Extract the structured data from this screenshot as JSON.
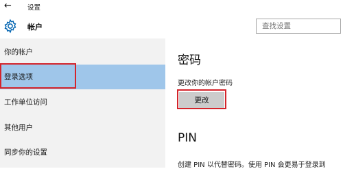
{
  "titlebar": {
    "back_icon": "back-arrow-icon",
    "title": "设置"
  },
  "header": {
    "gear_icon": "gear-icon",
    "title": "帐户"
  },
  "search": {
    "placeholder": "查找设置"
  },
  "sidebar": {
    "items": [
      {
        "label": "你的帐户",
        "selected": false
      },
      {
        "label": "登录选项",
        "selected": true
      },
      {
        "label": "工作单位访问",
        "selected": false
      },
      {
        "label": "其他用户",
        "selected": false
      },
      {
        "label": "同步你的设置",
        "selected": false
      }
    ]
  },
  "password_section": {
    "heading": "密码",
    "description": "更改你的帐户密码",
    "button_label": "更改"
  },
  "pin_section": {
    "heading": "PIN",
    "description": "创建 PIN 以代替密码。使用 PIN 会更易于登录到"
  },
  "colors": {
    "selected_bg": "#9fc6ea",
    "sidebar_bg": "#f2f2f2",
    "highlight_border": "#d4242b",
    "button_bg": "#cccccc",
    "gear_color": "#0063b1"
  }
}
